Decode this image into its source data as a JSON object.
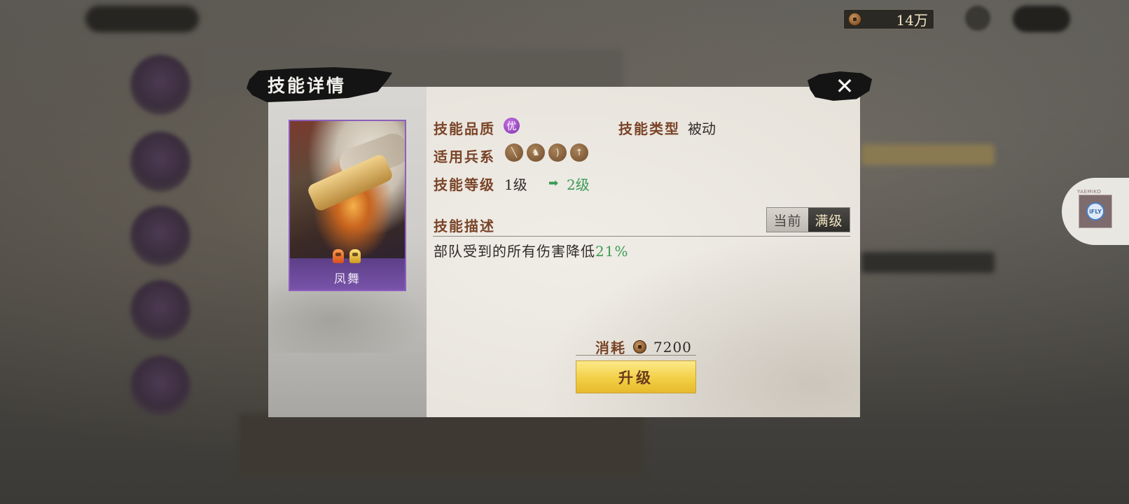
{
  "header": {
    "currency_value": "14万",
    "currency_icon": "coin-icon"
  },
  "assistant": {
    "label": "YAEMIKO",
    "badge": "iFLY"
  },
  "modal": {
    "title": "技能详情",
    "close_symbol": "✕"
  },
  "skill_card": {
    "name": "凤舞"
  },
  "info": {
    "quality_label": "技能品质",
    "quality_badge": "优",
    "type_label": "技能类型",
    "type_value": "被动",
    "troop_label": "适用兵系",
    "troop_icons": [
      "blade-icon",
      "horse-icon",
      "bow-icon",
      "spear-icon"
    ],
    "level_label": "技能等级",
    "level_current": "1级",
    "level_arrow": "➡",
    "level_next": "2级",
    "desc_label": "技能描述",
    "toggle_current": "当前",
    "toggle_max": "满级",
    "desc_text": "部队受到的所有伤害降低",
    "desc_percent": "21%"
  },
  "cost": {
    "label": "消耗",
    "value": "7200"
  },
  "actions": {
    "upgrade_label": "升级"
  },
  "colors": {
    "label_brown": "#7a4428",
    "green_highlight": "#3c9a54",
    "card_purple": "#8b5fbe",
    "button_gold": "#f2cf45"
  }
}
